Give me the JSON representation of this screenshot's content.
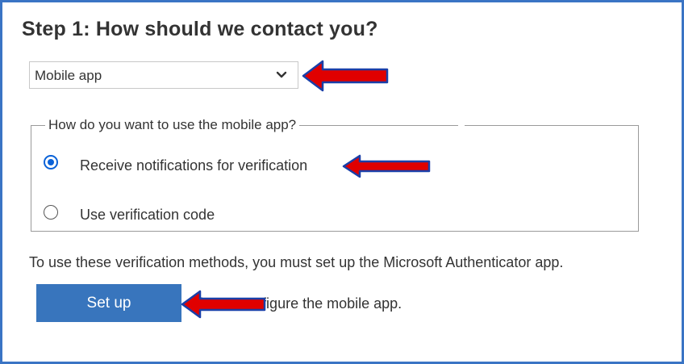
{
  "step_title": "Step 1: How should we contact you?",
  "contact_method": {
    "selected": "Mobile app"
  },
  "mobile_options": {
    "legend": "How do you want to use the mobile app?",
    "options": [
      {
        "label": "Receive notifications for verification",
        "checked": true
      },
      {
        "label": "Use verification code",
        "checked": false
      }
    ]
  },
  "info_text": "To use these verification methods, you must set up the Microsoft Authenticator app.",
  "setup_button": "Set up",
  "configure_text": "Please configure the mobile app.",
  "colors": {
    "frame": "#3a74c4",
    "button": "#3875bd",
    "radio_checked": "#0a62d8",
    "annotation_arrow": "#e00000",
    "annotation_arrow_outline": "#1a3fa8"
  },
  "icons": {
    "dropdown": "chevron-down-icon",
    "annotation": "red-arrow-icon"
  }
}
